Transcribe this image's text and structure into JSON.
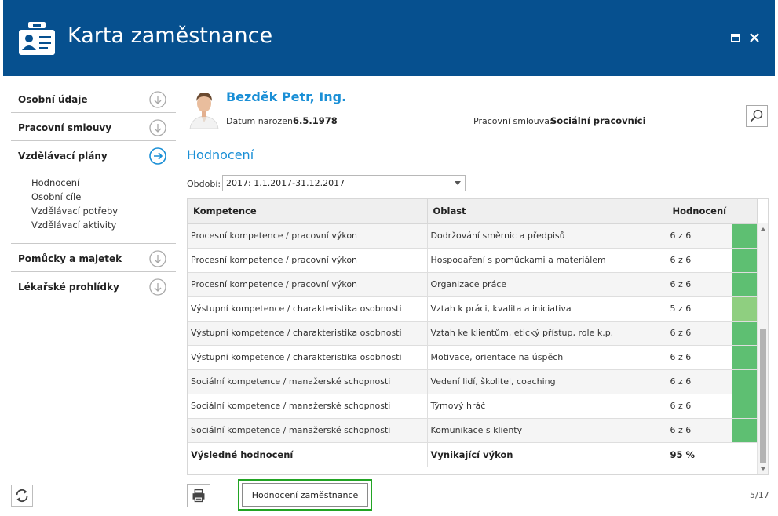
{
  "window": {
    "title": "Karta zaměstnance"
  },
  "sidebar": {
    "sections": [
      {
        "label": "Osobní údaje"
      },
      {
        "label": "Pracovní smlouvy"
      },
      {
        "label": "Vzdělávací plány"
      },
      {
        "label": "Pomůcky a majetek"
      },
      {
        "label": "Lékařské prohlídky"
      }
    ],
    "subitems": [
      "Hodnocení",
      "Osobní cíle",
      "Vzdělávací potřeby",
      "Vzdělávací aktivity"
    ]
  },
  "employee": {
    "name": "Bezděk Petr, Ing.",
    "dob_label": "Datum narození:",
    "dob": "6.5.1978",
    "contract_label": "Pracovní smlouva:",
    "contract": "Sociální pracovníci"
  },
  "section_title": "Hodnocení",
  "period": {
    "label": "Období:",
    "value": "2017: 1.1.2017-31.12.2017"
  },
  "grid": {
    "headers": [
      "Kompetence",
      "Oblast",
      "Hodnocení"
    ],
    "rows": [
      {
        "competence": "Procesní kompetence / pracovní výkon",
        "area": "Dodržování směrnic a předpisů",
        "rating": "6 z 6",
        "score": 6
      },
      {
        "competence": "Procesní kompetence / pracovní výkon",
        "area": "Hospodaření s pomůckami a materiálem",
        "rating": "6 z 6",
        "score": 6
      },
      {
        "competence": "Procesní kompetence / pracovní výkon",
        "area": "Organizace práce",
        "rating": "6 z 6",
        "score": 6
      },
      {
        "competence": "Výstupní kompetence / charakteristika osobnosti",
        "area": "Vztah k práci, kvalita a iniciativa",
        "rating": "5 z 6",
        "score": 5
      },
      {
        "competence": "Výstupní kompetence / charakteristika osobnosti",
        "area": "Vztah ke klientům, etický přístup, role k.p.",
        "rating": "6 z 6",
        "score": 6
      },
      {
        "competence": "Výstupní kompetence / charakteristika osobnosti",
        "area": "Motivace, orientace na úspěch",
        "rating": "6 z 6",
        "score": 6
      },
      {
        "competence": "Sociální kompetence / manažerské schopnosti",
        "area": "Vedení lidí, školitel, coaching",
        "rating": "6 z 6",
        "score": 6
      },
      {
        "competence": "Sociální kompetence / manažerské schopnosti",
        "area": "Týmový hráč",
        "rating": "6 z 6",
        "score": 6
      },
      {
        "competence": "Sociální kompetence / manažerské schopnosti",
        "area": "Komunikace s klienty",
        "rating": "6 z 6",
        "score": 6
      }
    ],
    "total": {
      "label": "Výsledné hodnocení",
      "area": "Vynikající výkon",
      "rating": "95 %"
    }
  },
  "colors": {
    "header_bg": "#06508f",
    "accent": "#1a8fd6",
    "score_full": "#5ebf72",
    "score_partial": "#8fcf80",
    "highlight": "#22a424"
  },
  "footer": {
    "eval_button": "Hodnocení zaměstnance",
    "page": "5/17"
  },
  "icons": [
    "id-card-icon",
    "maximize-icon",
    "close-icon",
    "arrow-down-circle-icon",
    "arrow-right-circle-icon",
    "refresh-icon",
    "search-icon",
    "print-icon",
    "avatar-photo"
  ]
}
